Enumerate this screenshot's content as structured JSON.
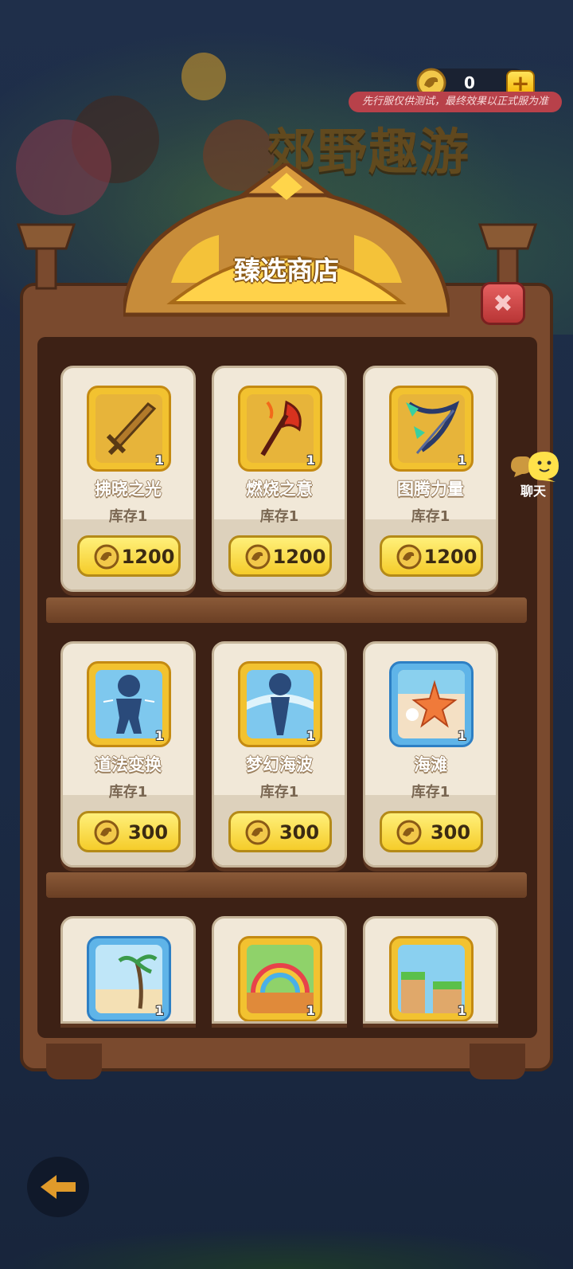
{
  "background": {
    "game_title": "郊野趣游"
  },
  "currency": {
    "amount": "0",
    "add_label": "+",
    "notice": "先行服仅供测试，最终效果以正式服为准"
  },
  "shop": {
    "title": "臻选商店",
    "close_label": "✖"
  },
  "items": [
    {
      "name": "拂晓之光",
      "stock": "库存1",
      "price": "1200",
      "qty": "1",
      "icon": "golden-sword-icon"
    },
    {
      "name": "燃烧之意",
      "stock": "库存1",
      "price": "1200",
      "qty": "1",
      "icon": "flame-axe-icon"
    },
    {
      "name": "图腾力量",
      "stock": "库存1",
      "price": "1200",
      "qty": "1",
      "icon": "totem-bow-icon"
    },
    {
      "name": "道法变换",
      "stock": "库存1",
      "price": "300",
      "qty": "1",
      "icon": "silhouette-pose-icon"
    },
    {
      "name": "梦幻海波",
      "stock": "库存1",
      "price": "300",
      "qty": "1",
      "icon": "silhouette-wave-icon"
    },
    {
      "name": "海滩",
      "stock": "库存1",
      "price": "300",
      "qty": "1",
      "icon": "starfish-beach-icon"
    },
    {
      "qty": "1",
      "icon": "palm-beach-icon"
    },
    {
      "qty": "1",
      "icon": "rainbow-icon"
    },
    {
      "qty": "1",
      "icon": "green-hills-icon"
    }
  ],
  "chat": {
    "label": "聊天"
  },
  "colors": {
    "background": "#1b2a44",
    "cabinet": "#7a4a2e",
    "card": "#f1e8d8",
    "gold_frame": "#f2c230",
    "blue_frame": "#5fb4e8",
    "buy_button": "#f5cc2a"
  }
}
